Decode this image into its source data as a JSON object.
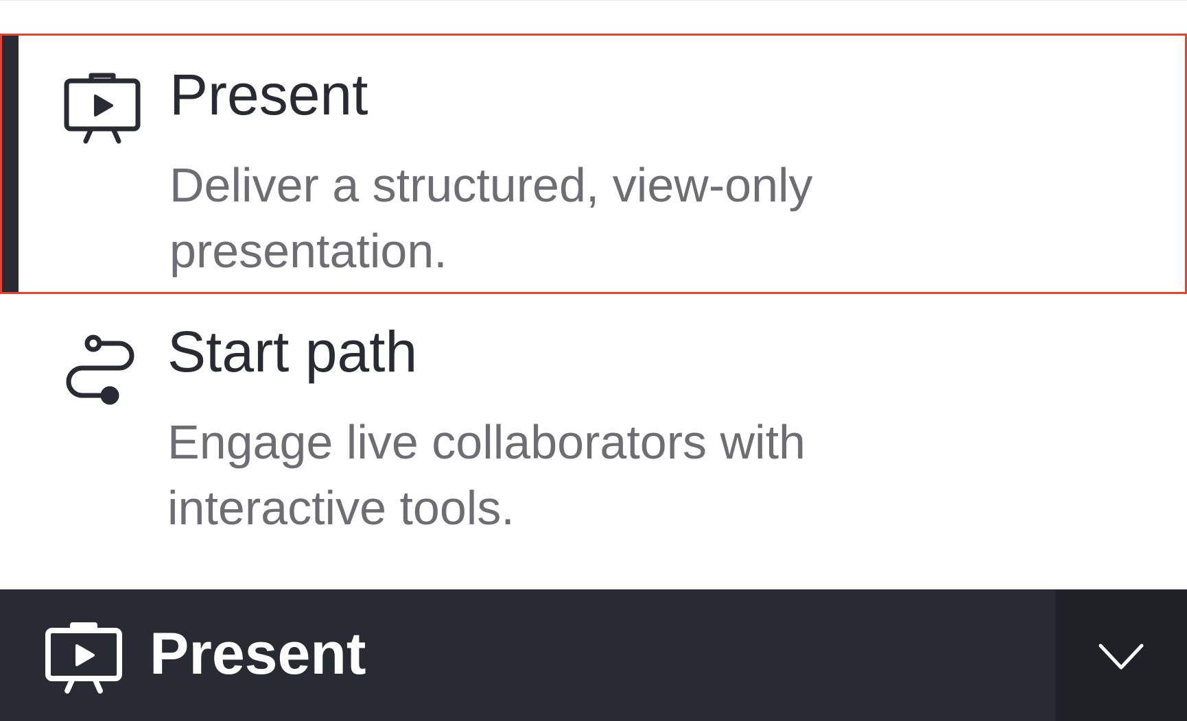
{
  "menu": {
    "options": [
      {
        "title": "Present",
        "description": "Deliver a structured, view-only presentation.",
        "icon": "present-easel-icon",
        "selected": true
      },
      {
        "title": "Start path",
        "description": "Engage live collaborators with interactive tools.",
        "icon": "path-icon",
        "selected": false
      }
    ]
  },
  "button": {
    "label": "Present",
    "icon": "present-easel-icon",
    "toggle_icon": "chevron-down-icon"
  },
  "colors": {
    "text_primary": "#282b33",
    "text_secondary": "#6c6e74",
    "bar_background": "#282b33",
    "toggle_background": "#1f2127",
    "focus_outline": "#e5432e"
  }
}
